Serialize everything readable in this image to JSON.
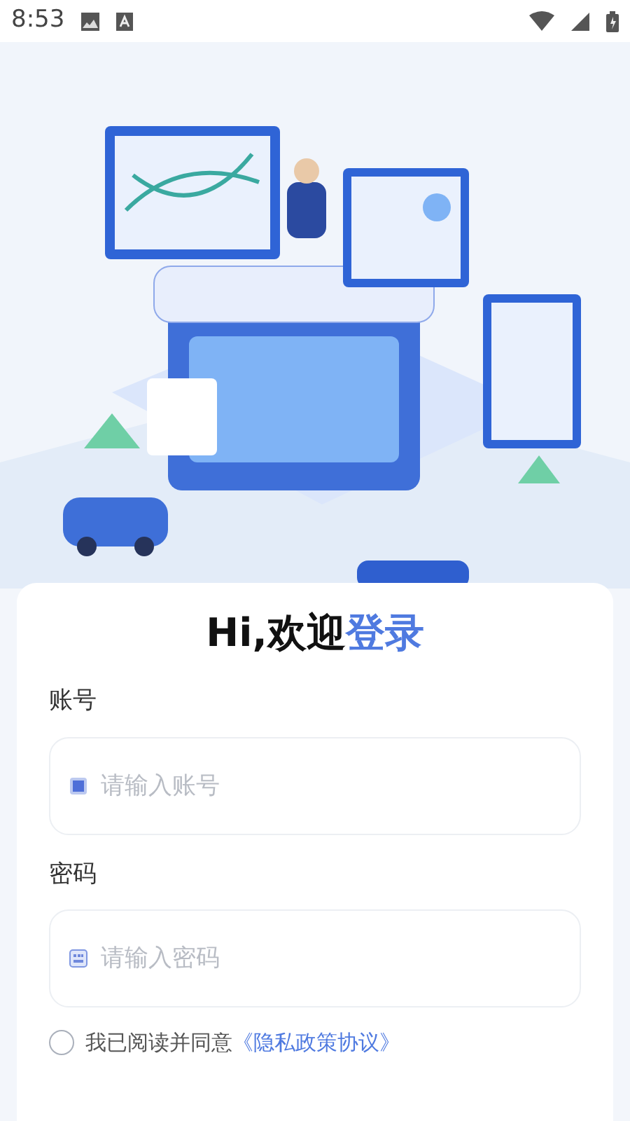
{
  "status_bar": {
    "time": "8:53"
  },
  "login": {
    "title": "Hi,欢迎",
    "title_highlight": "登录",
    "fields": [
      {
        "label": "账号",
        "placeholder": "请输入账号",
        "kind": "account"
      },
      {
        "label": "密码",
        "placeholder": "请输入密码",
        "kind": "password"
      }
    ],
    "agreement": {
      "text": "我已阅读并同意",
      "link": "《隐私政策协议》",
      "checked": false
    }
  }
}
